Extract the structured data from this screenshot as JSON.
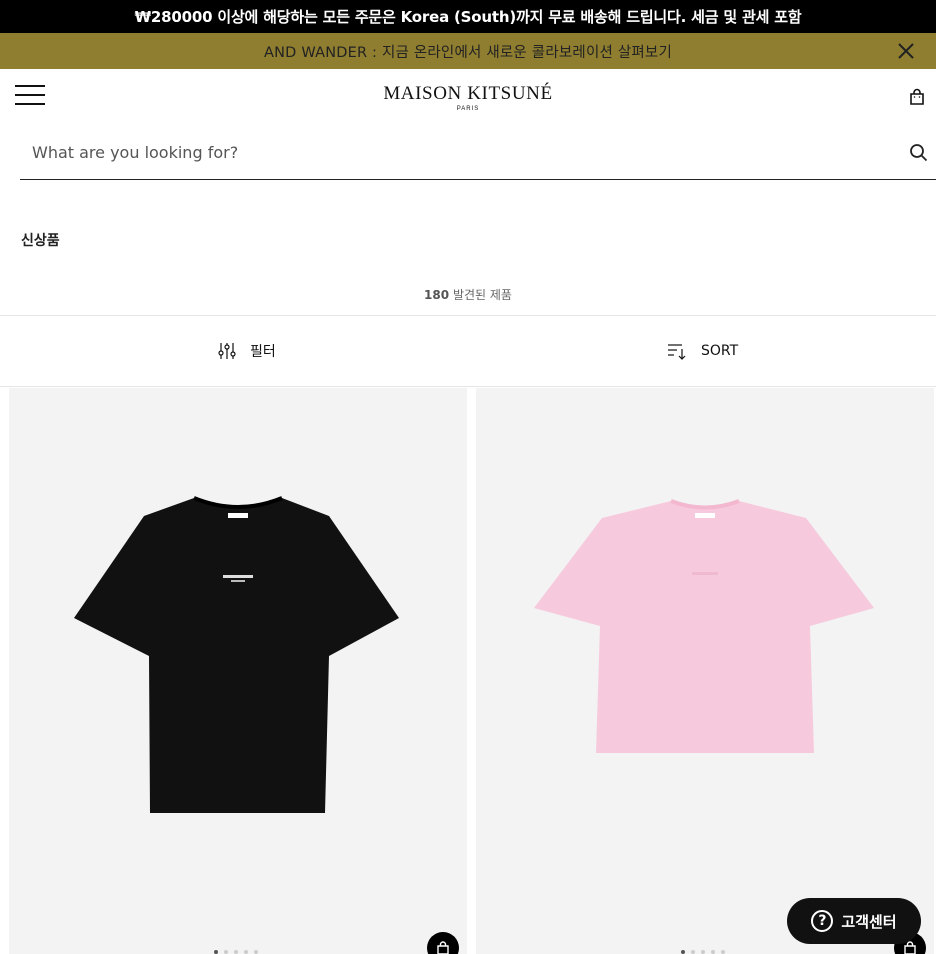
{
  "announcement": {
    "text": "₩280000 이상에 해당하는 모든 주문은 Korea (South)까지 무료 배송해 드립니다. 세금 및 관세 포함"
  },
  "promo": {
    "text": "AND WANDER : 지금 온라인에서 새로운 콜라보레이션 살펴보기",
    "close_icon": "close-icon",
    "background": "#8f7e2f"
  },
  "header": {
    "logo_main": "MAISON KITSUNÉ",
    "logo_sub": "PARIS",
    "menu_icon": "hamburger-icon",
    "bag_icon": "bag-icon"
  },
  "search": {
    "placeholder": "What are you looking for?",
    "value": "",
    "icon": "search-icon"
  },
  "page": {
    "title": "신상품",
    "count_number": "180",
    "count_label": "발견된 제품"
  },
  "toolbar": {
    "filter_label": "필터",
    "sort_label": "SORT"
  },
  "products": [
    {
      "color": "#111111",
      "image_icon": "black-tshirt",
      "dots": 5,
      "active_dot": 0
    },
    {
      "color": "#f7c9dd",
      "image_icon": "pink-tshirt",
      "dots": 5,
      "active_dot": 0
    }
  ],
  "help": {
    "label": "고객센터",
    "icon": "help-icon"
  }
}
